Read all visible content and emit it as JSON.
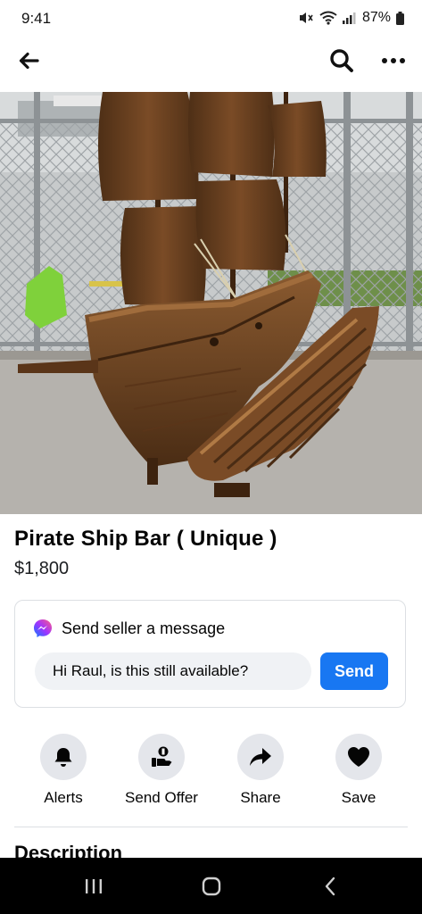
{
  "status_bar": {
    "time": "9:41",
    "battery": "87%",
    "icons": [
      "mute-icon",
      "wifi-icon",
      "signal-icon",
      "battery-icon"
    ]
  },
  "app_bar": {
    "icons": [
      "back-arrow-icon",
      "search-icon",
      "more-icon"
    ]
  },
  "hero": {
    "image_count": 7,
    "active_index": 4
  },
  "listing": {
    "title": "Pirate Ship Bar ( Unique )",
    "price": "$1,800"
  },
  "message_box": {
    "header": "Send seller a message",
    "input_value": "Hi Raul, is this still available?",
    "send_label": "Send"
  },
  "actions": [
    {
      "label": "Alerts",
      "icon": "bell-icon"
    },
    {
      "label": "Send Offer",
      "icon": "send-offer-icon"
    },
    {
      "label": "Share",
      "icon": "share-icon"
    },
    {
      "label": "Save",
      "icon": "heart-icon"
    }
  ],
  "description_heading": "Description",
  "nav_bar": {
    "icons": [
      "recents-icon",
      "home-icon",
      "back-icon"
    ]
  },
  "colors": {
    "accent": "#1877f2",
    "wood": "#6b4423",
    "card_border": "#dcdfe3",
    "action_circle": "#e4e6eb"
  }
}
